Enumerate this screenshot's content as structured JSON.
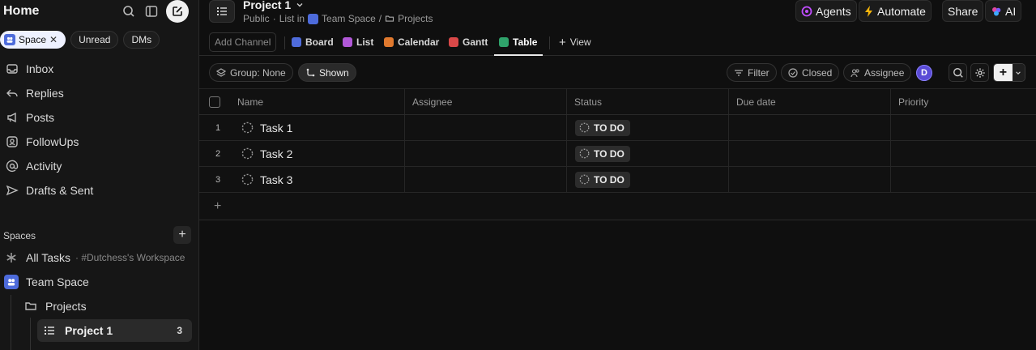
{
  "sidebar": {
    "title": "Home",
    "chips": [
      {
        "label": "Space",
        "active": true,
        "close": "✕"
      },
      {
        "label": "Unread",
        "active": false
      },
      {
        "label": "DMs",
        "active": false
      }
    ],
    "nav": [
      {
        "label": "Inbox",
        "icon": "inbox-icon"
      },
      {
        "label": "Replies",
        "icon": "reply-icon"
      },
      {
        "label": "Posts",
        "icon": "megaphone-icon"
      },
      {
        "label": "FollowUps",
        "icon": "followup-icon"
      },
      {
        "label": "Activity",
        "icon": "at-icon"
      },
      {
        "label": "Drafts & Sent",
        "icon": "send-icon"
      }
    ],
    "spaces_title": "Spaces",
    "all_tasks": {
      "label": "All Tasks",
      "sub": "· #Dutchess's Workspace"
    },
    "team_space": "Team Space",
    "projects_folder": "Projects",
    "active_list": {
      "label": "Project 1",
      "count": "3"
    }
  },
  "header": {
    "project_title": "Project 1",
    "breadcrumb": {
      "visibility": "Public",
      "sep1": "·",
      "list_in": "List in",
      "space": "Team Space",
      "sep2": "/",
      "folder": "Projects"
    },
    "agents": "Agents",
    "automate": "Automate",
    "share": "Share",
    "ai": "AI"
  },
  "tabs": {
    "add_channel": "Add Channel",
    "views": [
      {
        "label": "Board",
        "color": "#4f6cdc"
      },
      {
        "label": "List",
        "color": "#b158d8"
      },
      {
        "label": "Calendar",
        "color": "#e0792e"
      },
      {
        "label": "Gantt",
        "color": "#d94848"
      },
      {
        "label": "Table",
        "color": "#2fa36b",
        "active": true
      }
    ],
    "add_view": "View"
  },
  "toolbar": {
    "group": "Group: None",
    "shown": "Shown",
    "filter": "Filter",
    "closed": "Closed",
    "assignee": "Assignee",
    "avatar": "D"
  },
  "table": {
    "columns": [
      "Name",
      "Assignee",
      "Status",
      "Due date",
      "Priority"
    ],
    "rows": [
      {
        "num": "1",
        "name": "Task 1",
        "status": "TO DO"
      },
      {
        "num": "2",
        "name": "Task 2",
        "status": "TO DO"
      },
      {
        "num": "3",
        "name": "Task 3",
        "status": "TO DO"
      }
    ],
    "add_row": "+"
  }
}
